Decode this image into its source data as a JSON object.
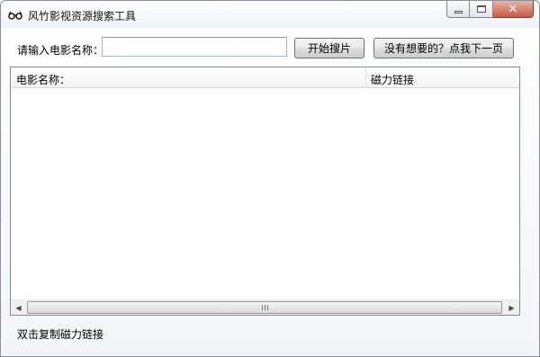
{
  "window": {
    "title": "风竹影视资源搜索工具",
    "app_icon": "glasses-icon"
  },
  "caption_buttons": {
    "minimize_icon": "minimize-icon",
    "maximize_icon": "maximize-icon",
    "close_icon": "close-icon",
    "close_glyph": "✕"
  },
  "search": {
    "label": "请输入电影名称：",
    "value": "",
    "placeholder": ""
  },
  "buttons": {
    "start_label": "开始搜片",
    "next_label": "没有想要的？点我下一页"
  },
  "results": {
    "columns": [
      "电影名称：",
      "磁力链接"
    ],
    "rows": []
  },
  "scrollbar": {
    "left_arrow_icon": "scroll-left-icon",
    "right_arrow_icon": "scroll-right-icon",
    "left_glyph": "◀",
    "right_glyph": "▶"
  },
  "status": {
    "text": "双击复制磁力链接"
  },
  "colors": {
    "close_button": "#c75b45",
    "border": "#828790"
  }
}
